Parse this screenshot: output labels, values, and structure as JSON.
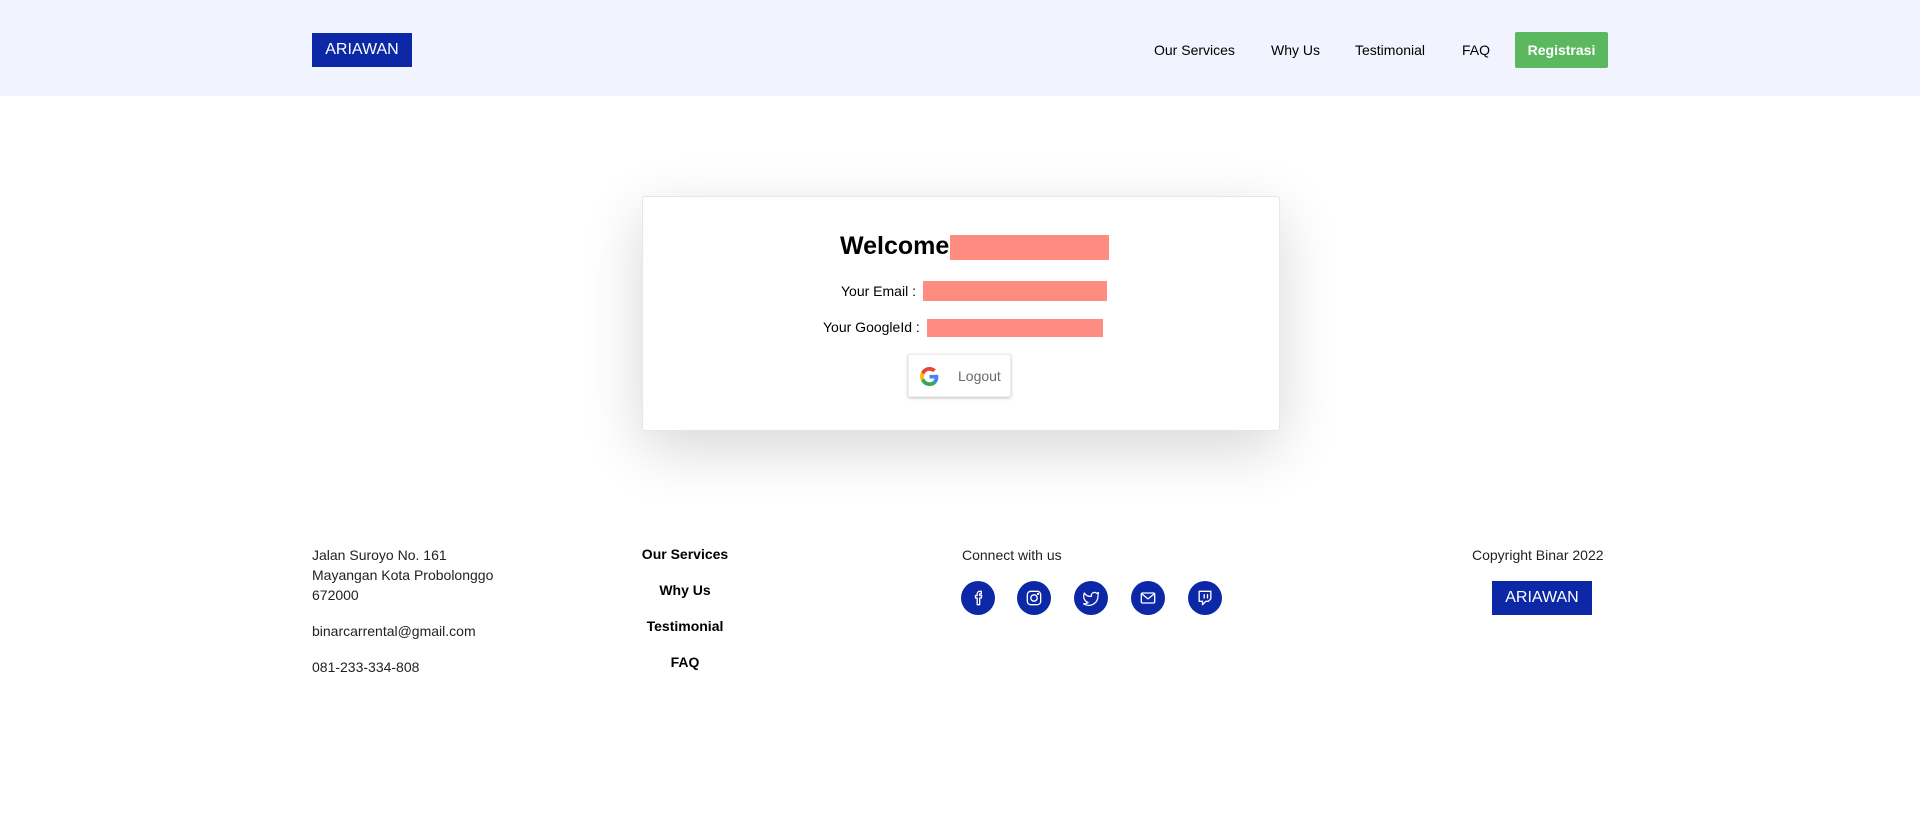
{
  "header": {
    "logo": "ARIAWAN",
    "nav": [
      "Our Services",
      "Why Us",
      "Testimonial",
      "FAQ"
    ],
    "register_label": "Registrasi"
  },
  "profile": {
    "welcome": "Welcome",
    "email_label": "Your Email :",
    "googleid_label": "Your GoogleId :",
    "logout_label": "Logout"
  },
  "footer": {
    "address_line1": "Jalan Suroyo No. 161",
    "address_line2": "Mayangan Kota Probolonggo",
    "address_line3": "672000",
    "email": "binarcarrental@gmail.com",
    "phone": "081-233-334-808",
    "links": [
      "Our Services",
      "Why Us",
      "Testimonial",
      "FAQ"
    ],
    "connect_label": "Connect with us",
    "social_icons": [
      "facebook-icon",
      "instagram-icon",
      "twitter-icon",
      "mail-icon",
      "twitch-icon"
    ],
    "copyright": "Copyright Binar 2022",
    "logo": "ARIAWAN"
  },
  "colors": {
    "brand": "#0d28a6",
    "register": "#5cb85f",
    "header_bg": "#f1f3fe",
    "redaction": "#ff8c80"
  }
}
